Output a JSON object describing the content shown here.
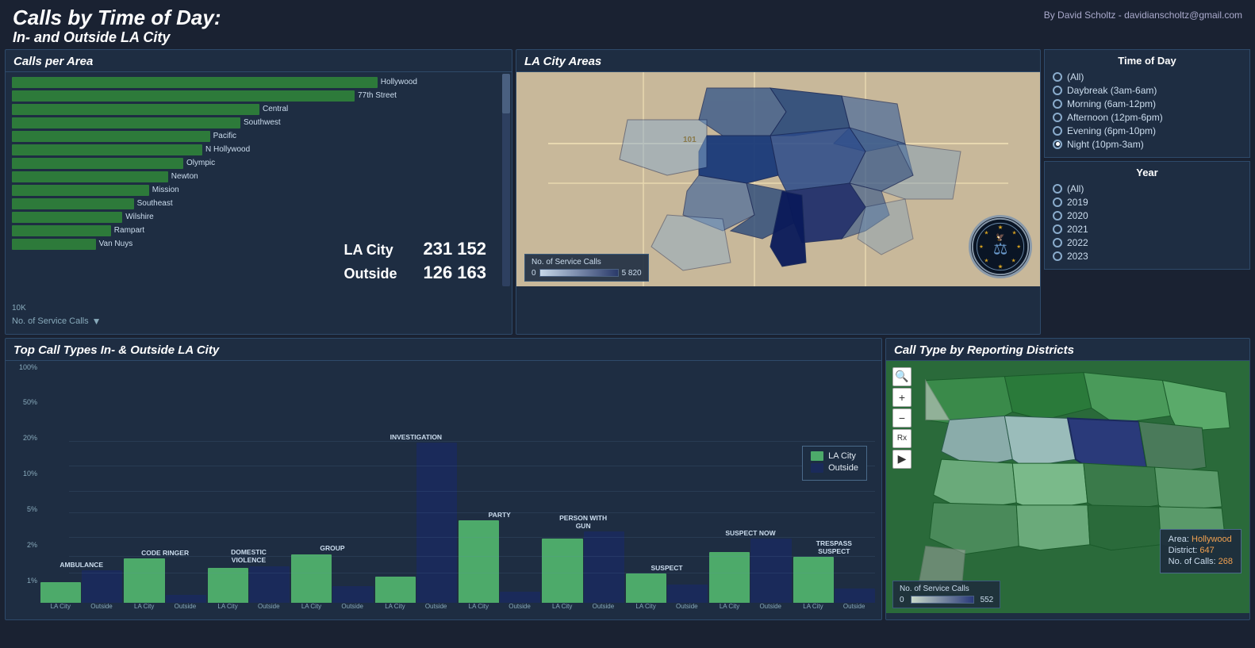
{
  "header": {
    "title_line1": "Calls by Time of Day:",
    "title_line2": "In- and Outside LA City",
    "credit": "By David Scholtz - davidianscholtz@gmail.com"
  },
  "calls_per_area": {
    "panel_title": "Calls per Area",
    "bars": [
      {
        "label": "Hollywood",
        "pct": 96
      },
      {
        "label": "77th Street",
        "pct": 90
      },
      {
        "label": "Central",
        "pct": 65
      },
      {
        "label": "Southwest",
        "pct": 60
      },
      {
        "label": "Pacific",
        "pct": 52
      },
      {
        "label": "N Hollywood",
        "pct": 50
      },
      {
        "label": "Olympic",
        "pct": 45
      },
      {
        "label": "Newton",
        "pct": 41
      },
      {
        "label": "Mission",
        "pct": 36
      },
      {
        "label": "Southeast",
        "pct": 32
      },
      {
        "label": "Wilshire",
        "pct": 29
      },
      {
        "label": "Rampart",
        "pct": 26
      },
      {
        "label": "Van Nuys",
        "pct": 22
      }
    ],
    "axis_label": "10K",
    "x_axis_label": "No. of Service Calls",
    "la_city_label": "LA City",
    "la_city_value": "231 152",
    "outside_label": "Outside",
    "outside_value": "126 163"
  },
  "la_city_areas": {
    "panel_title": "LA City Areas",
    "legend_title": "No. of Service Calls",
    "legend_min": "0",
    "legend_max": "5 820"
  },
  "filters": {
    "time_of_day": {
      "title": "Time of Day",
      "options": [
        {
          "label": "(All)",
          "selected": false
        },
        {
          "label": "Daybreak (3am-6am)",
          "selected": false
        },
        {
          "label": "Morning (6am-12pm)",
          "selected": false
        },
        {
          "label": "Afternoon (12pm-6pm)",
          "selected": false
        },
        {
          "label": "Evening (6pm-10pm)",
          "selected": false
        },
        {
          "label": "Night (10pm-3am)",
          "selected": true
        }
      ]
    },
    "year": {
      "title": "Year",
      "options": [
        {
          "label": "(All)",
          "selected": false
        },
        {
          "label": "2019",
          "selected": false
        },
        {
          "label": "2020",
          "selected": false
        },
        {
          "label": "2021",
          "selected": false
        },
        {
          "label": "2022",
          "selected": false
        },
        {
          "label": "2023",
          "selected": false
        }
      ]
    }
  },
  "top_call_types": {
    "panel_title": "Top Call Types In- & Outside LA City",
    "categories": [
      {
        "label": "AMBULANCE",
        "city_pct": 22,
        "outside_pct": 35
      },
      {
        "label": "CODE RINGER",
        "city_pct": 48,
        "outside_pct": 8
      },
      {
        "label": "DOMESTIC\nVIOLENCE",
        "city_pct": 38,
        "outside_pct": 40
      },
      {
        "label": "GROUP",
        "city_pct": 53,
        "outside_pct": 18
      },
      {
        "label": "INVESTIGATION",
        "city_pct": 28,
        "outside_pct": 175
      },
      {
        "label": "PARTY",
        "city_pct": 90,
        "outside_pct": 12
      },
      {
        "label": "PERSON WITH\nGUN",
        "city_pct": 70,
        "outside_pct": 78
      },
      {
        "label": "SUSPECT",
        "city_pct": 32,
        "outside_pct": 20
      },
      {
        "label": "SUSPECT NOW",
        "city_pct": 55,
        "outside_pct": 70
      },
      {
        "label": "TRESPASS\nSUSPECT",
        "city_pct": 50,
        "outside_pct": 15
      }
    ],
    "y_labels": [
      "100%",
      "50%",
      "20%",
      "10%",
      "5%",
      "2%",
      "1%"
    ],
    "legend_city": "LA City",
    "legend_outside": "Outside",
    "x_sublabels": [
      "LA City",
      "Outside"
    ]
  },
  "call_type_districts": {
    "panel_title": "Call Type by Reporting Districts",
    "tooltip": {
      "area_label": "Area:",
      "area_value": "Hollywood",
      "district_label": "District:",
      "district_value": "647",
      "calls_label": "No. of Calls:",
      "calls_value": "268"
    },
    "legend_title": "No. of Service Calls",
    "legend_min": "0",
    "legend_max": "552"
  },
  "colors": {
    "background": "#1a2232",
    "panel_bg": "#1e2d42",
    "panel_border": "#2e4a6a",
    "bar_green": "#2d7a3a",
    "bar_city_light": "#4daa6a",
    "bar_outside_dark": "#1a2a5a",
    "text_light": "#e0e8f0",
    "text_dim": "#8aaccc"
  }
}
